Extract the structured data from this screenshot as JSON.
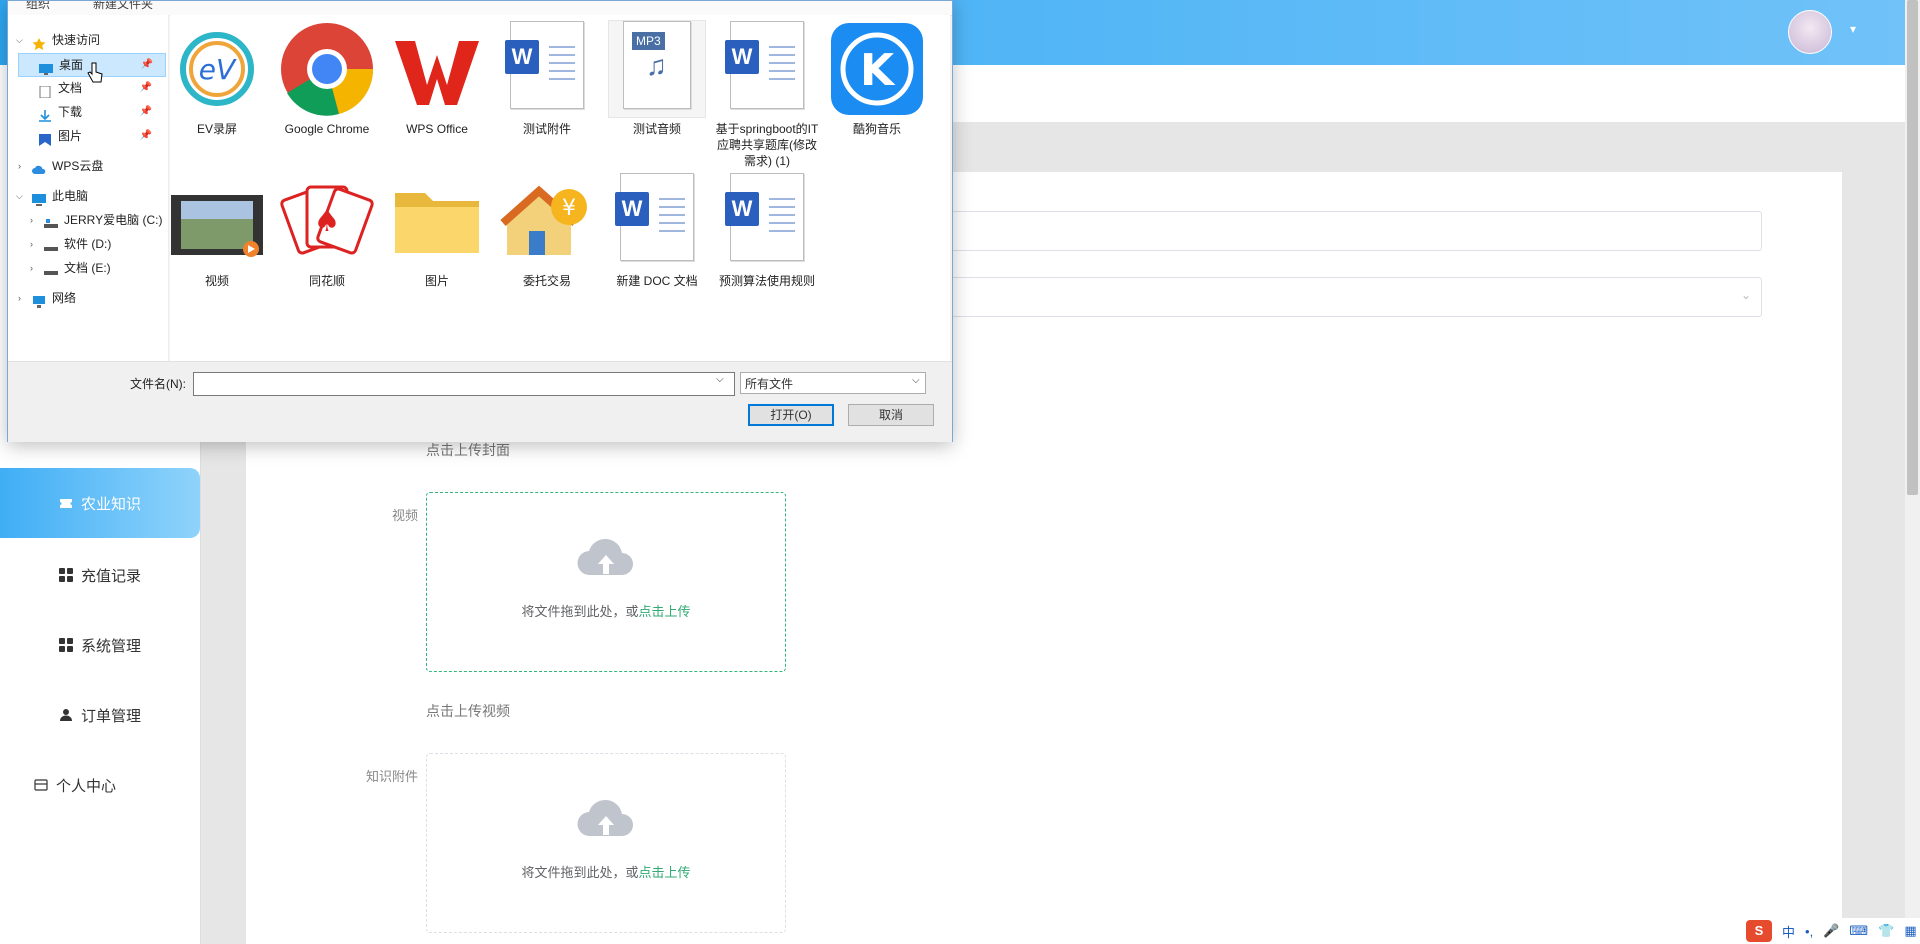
{
  "header": {
    "avatar_caret": "▾"
  },
  "sidebar": {
    "items": [
      {
        "label": "农业知识",
        "icon": "ticket-icon",
        "active": true
      },
      {
        "label": "充值记录",
        "icon": "grid-icon"
      },
      {
        "label": "系统管理",
        "icon": "grid-icon"
      },
      {
        "label": "订单管理",
        "icon": "user-icon"
      },
      {
        "label": "个人中心",
        "icon": "card-icon"
      }
    ]
  },
  "form": {
    "cover_hint": "点击上传封面",
    "video_label": "视频",
    "video_upload": {
      "text": "将文件拖到此处，或",
      "link": "点击上传"
    },
    "video_hint": "点击上传视频",
    "attachment_label": "知识附件",
    "attachment_upload": {
      "text": "将文件拖到此处，或",
      "link": "点击上传"
    }
  },
  "dialog": {
    "top_items": [
      "组织",
      "新建文件夹"
    ],
    "tree": {
      "quick_access": "快速访问",
      "desktop": "桌面",
      "documents": "文档",
      "downloads": "下载",
      "pictures": "图片",
      "wps_cloud": "WPS云盘",
      "this_pc": "此电脑",
      "drive_c": "JERRY爱电脑 (C:)",
      "drive_d": "软件 (D:)",
      "drive_e": "文档 (E:)",
      "network": "网络"
    },
    "files": [
      {
        "name": "EV录屏"
      },
      {
        "name": "Google Chrome"
      },
      {
        "name": "WPS Office"
      },
      {
        "name": "测试附件"
      },
      {
        "name": "测试音频",
        "badge": "MP3"
      },
      {
        "name": "基于springboot的IT应聘共享题库(修改需求) (1)"
      },
      {
        "name": "酷狗音乐",
        "badge": "K"
      },
      {
        "name": "视频"
      },
      {
        "name": "同花顺"
      },
      {
        "name": "图片"
      },
      {
        "name": "委托交易"
      },
      {
        "name": "新建 DOC 文档"
      },
      {
        "name": "预测算法使用规则"
      }
    ],
    "filename_label": "文件名(N):",
    "filename_value": "",
    "filetype": "所有文件",
    "open_button": "打开(O)",
    "cancel_button": "取消"
  },
  "tray": {
    "ime": "中",
    "punct": "•,",
    "sogou": "S"
  }
}
